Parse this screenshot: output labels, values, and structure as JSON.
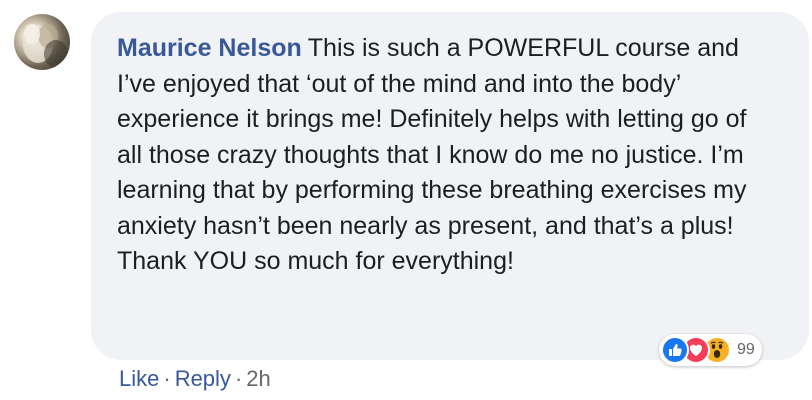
{
  "comment": {
    "author": "Maurice Nelson",
    "text": "This is such a POWERFUL course and I’ve enjoyed that ‘out of the mind and into the body’ experience it brings me! Definitely helps with letting go of all those crazy thoughts that I know do me no justice. I’m learning that by performing these breathing exercises my anxiety hasn’t been nearly as present, and that’s a plus! Thank YOU so much for everything!"
  },
  "reactions": {
    "icons": [
      "like-icon",
      "love-icon",
      "wow-icon"
    ],
    "count": "99",
    "colors": {
      "like": "#1877f2",
      "love": "#f33e58",
      "wow": "#f7b125"
    }
  },
  "actions": {
    "like_label": "Like",
    "reply_label": "Reply",
    "separator": "·",
    "timestamp": "2h"
  },
  "colors": {
    "bubble": "#f0f2f5",
    "author": "#385898",
    "text": "#1c1e21",
    "meta": "#65676b"
  }
}
